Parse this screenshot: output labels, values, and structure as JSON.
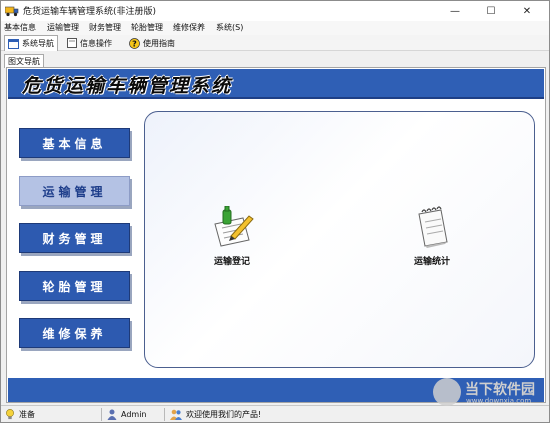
{
  "window": {
    "title": "危货运输车辆管理系统(非注册版)",
    "minimize_glyph": "—",
    "maximize_glyph": "☐",
    "close_glyph": "✕"
  },
  "menu": [
    "基本信息",
    "运输管理",
    "财务管理",
    "轮胎管理",
    "维修保养",
    "系统(S)"
  ],
  "toolbar": {
    "items": [
      {
        "label": "系统导航",
        "icon": "system-nav-icon"
      },
      {
        "label": "信息操作",
        "icon": "info-operation-icon"
      },
      {
        "label": "使用指南",
        "icon": "help-icon"
      }
    ]
  },
  "doc_tab": "图文导航",
  "banner": {
    "title": "危货运输车辆管理系统",
    "color": "#2f5fb5"
  },
  "nav": {
    "items": [
      {
        "label": "基本信息",
        "selected": false
      },
      {
        "label": "运输管理",
        "selected": true
      },
      {
        "label": "财务管理",
        "selected": false
      },
      {
        "label": "轮胎管理",
        "selected": false
      },
      {
        "label": "维修保养",
        "selected": false
      }
    ]
  },
  "features": [
    {
      "label": "运输登记",
      "icon": "transport-register-icon"
    },
    {
      "label": "运输统计",
      "icon": "transport-statistics-icon"
    }
  ],
  "status": {
    "ready": "准备",
    "user": "Admin",
    "welcome": "欢迎使用我们的产品!"
  },
  "watermark": {
    "text": "当下软件园",
    "url": "www.downxia.com"
  }
}
